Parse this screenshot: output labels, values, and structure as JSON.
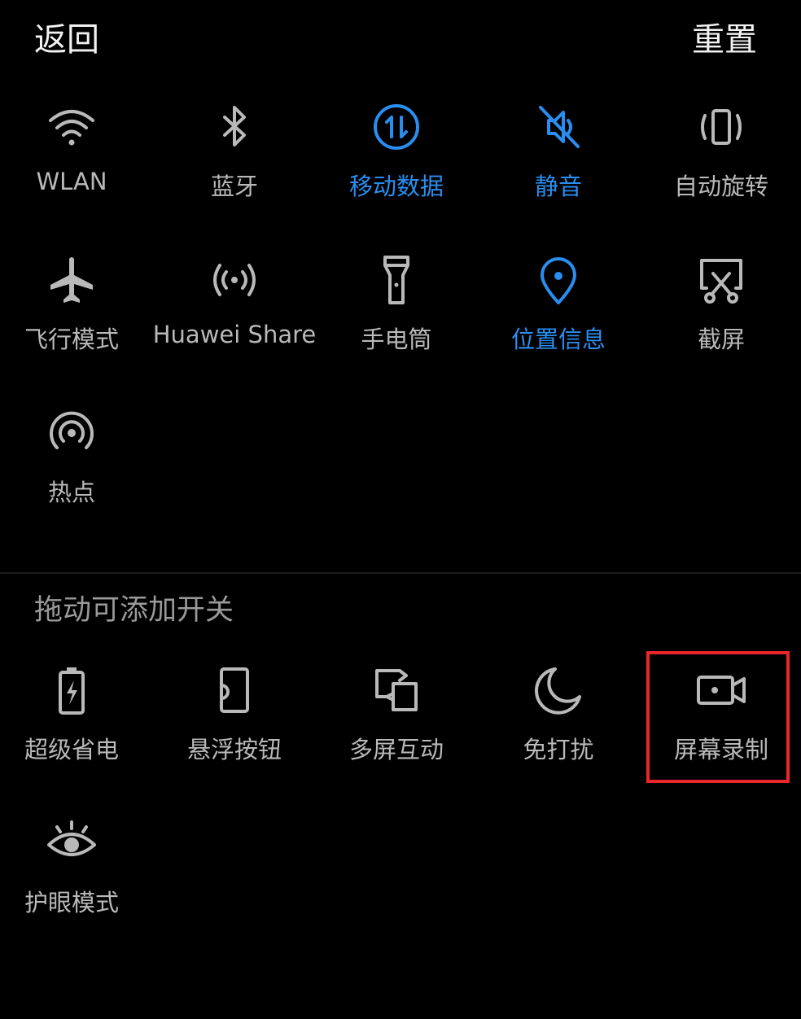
{
  "header": {
    "back_label": "返回",
    "reset_label": "重置"
  },
  "active_tiles": [
    {
      "id": "wlan",
      "label": "WLAN",
      "icon": "wifi-icon",
      "active": false
    },
    {
      "id": "bluetooth",
      "label": "蓝牙",
      "icon": "bluetooth-icon",
      "active": false
    },
    {
      "id": "mobile-data",
      "label": "移动数据",
      "icon": "mobile-data-icon",
      "active": true
    },
    {
      "id": "mute",
      "label": "静音",
      "icon": "mute-icon",
      "active": true
    },
    {
      "id": "auto-rotate",
      "label": "自动旋转",
      "icon": "auto-rotate-icon",
      "active": false
    },
    {
      "id": "airplane",
      "label": "飞行模式",
      "icon": "airplane-icon",
      "active": false
    },
    {
      "id": "huawei-share",
      "label": "Huawei Share",
      "icon": "huawei-share-icon",
      "active": false
    },
    {
      "id": "flashlight",
      "label": "手电筒",
      "icon": "flashlight-icon",
      "active": false
    },
    {
      "id": "location",
      "label": "位置信息",
      "icon": "location-icon",
      "active": true
    },
    {
      "id": "screenshot",
      "label": "截屏",
      "icon": "screenshot-icon",
      "active": false
    },
    {
      "id": "hotspot",
      "label": "热点",
      "icon": "hotspot-icon",
      "active": false
    }
  ],
  "available_section": {
    "title": "拖动可添加开关"
  },
  "available_tiles": [
    {
      "id": "power-saver",
      "label": "超级省电",
      "icon": "battery-saver-icon"
    },
    {
      "id": "floating-button",
      "label": "悬浮按钮",
      "icon": "floating-button-icon"
    },
    {
      "id": "multi-screen",
      "label": "多屏互动",
      "icon": "multi-screen-icon"
    },
    {
      "id": "do-not-disturb",
      "label": "免打扰",
      "icon": "moon-icon"
    },
    {
      "id": "screen-record",
      "label": "屏幕录制",
      "icon": "screen-record-icon",
      "highlighted": true
    },
    {
      "id": "eye-comfort",
      "label": "护眼模式",
      "icon": "eye-icon"
    }
  ],
  "colors": {
    "background": "#000000",
    "inactive": "#b9b9b9",
    "active": "#2a8ef0",
    "highlight_border": "#e8262c"
  }
}
